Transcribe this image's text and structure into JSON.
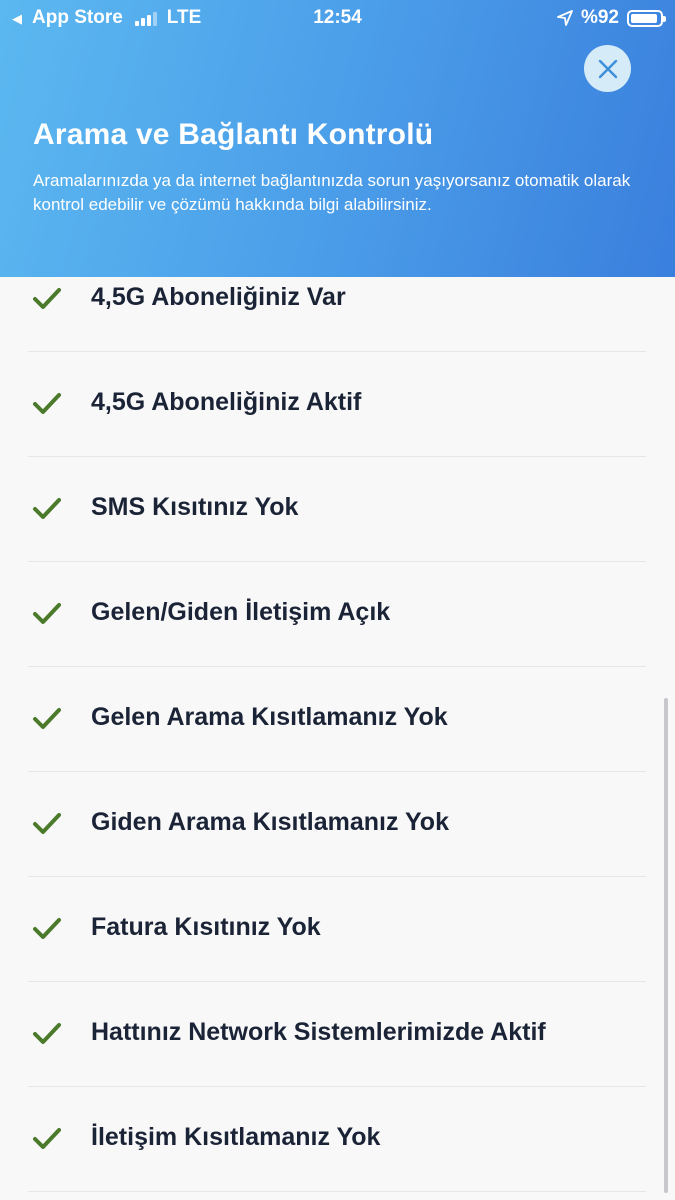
{
  "status_bar": {
    "back_app": "App Store",
    "network": "LTE",
    "time": "12:54",
    "battery": "%92",
    "battery_level": 0.92
  },
  "header": {
    "title": "Arama ve Bağlantı Kontrolü",
    "description": "Aramalarınızda ya da internet bağlantınızda sorun yaşıyorsanız otomatik olarak kontrol edebilir ve çözümü hakkında bilgi alabilirsiniz."
  },
  "colors": {
    "header_gradient_start": "#5cb8f0",
    "header_gradient_end": "#3a7fdd",
    "check_green": "#4a7a2a",
    "label_text": "#1b2436",
    "close_bg": "#d5ebf8",
    "close_icon": "#3d8fd8"
  },
  "checks": [
    {
      "label": "4,5G Aboneliğiniz Var",
      "icon": "check-icon"
    },
    {
      "label": "4,5G Aboneliğiniz Aktif",
      "icon": "check-icon"
    },
    {
      "label": "SMS Kısıtınız Yok",
      "icon": "check-icon"
    },
    {
      "label": "Gelen/Giden İletişim Açık",
      "icon": "check-icon"
    },
    {
      "label": "Gelen Arama Kısıtlamanız Yok",
      "icon": "check-icon"
    },
    {
      "label": "Giden Arama Kısıtlamanız Yok",
      "icon": "check-icon"
    },
    {
      "label": "Fatura Kısıtınız Yok",
      "icon": "check-icon"
    },
    {
      "label": "Hattınız Network Sistemlerimizde Aktif",
      "icon": "check-icon"
    },
    {
      "label": "İletişim Kısıtlamanız Yok",
      "icon": "check-icon"
    }
  ]
}
